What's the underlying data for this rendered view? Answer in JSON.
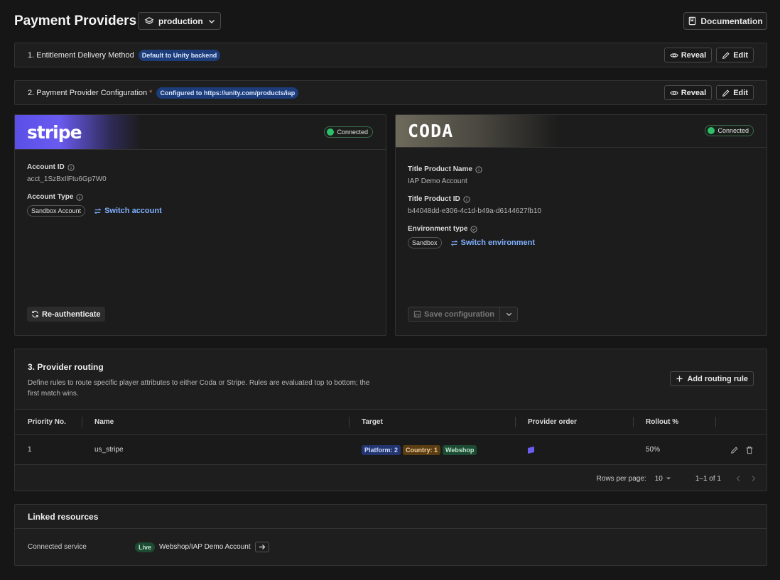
{
  "header": {
    "title": "Payment Providers",
    "environment": "production",
    "documentation_label": "Documentation"
  },
  "section1": {
    "title": "1. Entitlement Delivery Method",
    "badge": "Default to Unity backend",
    "reveal_label": "Reveal",
    "edit_label": "Edit"
  },
  "section2": {
    "title": "2. Payment Provider Configuration",
    "required_mark": "*",
    "badge": "Configured to https://unity.com/products/iap",
    "reveal_label": "Reveal",
    "edit_label": "Edit"
  },
  "stripe": {
    "logo": "stripe",
    "status": "Connected",
    "account_id_label": "Account ID",
    "account_id_value": "acct_1SzBxIlFtu6Gp7W0",
    "account_type_label": "Account Type",
    "account_type_value": "Sandbox Account",
    "switch_label": "Switch account",
    "reauth_label": "Re-authenticate"
  },
  "coda": {
    "logo": "CODA",
    "status": "Connected",
    "title_product_name_label": "Title Product Name",
    "title_product_name_value": "IAP Demo Account",
    "title_product_id_label": "Title Product ID",
    "title_product_id_value": "b44048dd-e306-4c1d-b49a-d6144627fb10",
    "environment_type_label": "Environment type",
    "environment_type_value": "Sandbox",
    "switch_label": "Switch environment",
    "save_label": "Save configuration"
  },
  "routing": {
    "title": "3. Provider routing",
    "description": "Define rules to route specific player attributes to either Coda or Stripe. Rules are evaluated top to bottom; the first match wins.",
    "add_label": "Add routing rule",
    "columns": [
      "Priority No.",
      "Name",
      "Target",
      "Provider order",
      "Rollout %"
    ],
    "rows": [
      {
        "priority": "1",
        "name": "us_stripe",
        "targets": [
          "Platform: 2",
          "Country: 1",
          "Webshop"
        ],
        "rollout": "50%"
      }
    ],
    "rows_per_page_label": "Rows per page:",
    "rows_per_page_value": "10",
    "range": "1–1 of 1"
  },
  "linked": {
    "title": "Linked resources",
    "connected_service_label": "Connected service",
    "status": "Live",
    "service_name": "Webshop/IAP Demo Account"
  },
  "colors": {
    "stripe_purple": "#635bff",
    "connected_green": "#2fbf6a",
    "link_blue": "#7fb0ff",
    "badge_blue": "#1c3d7a"
  }
}
